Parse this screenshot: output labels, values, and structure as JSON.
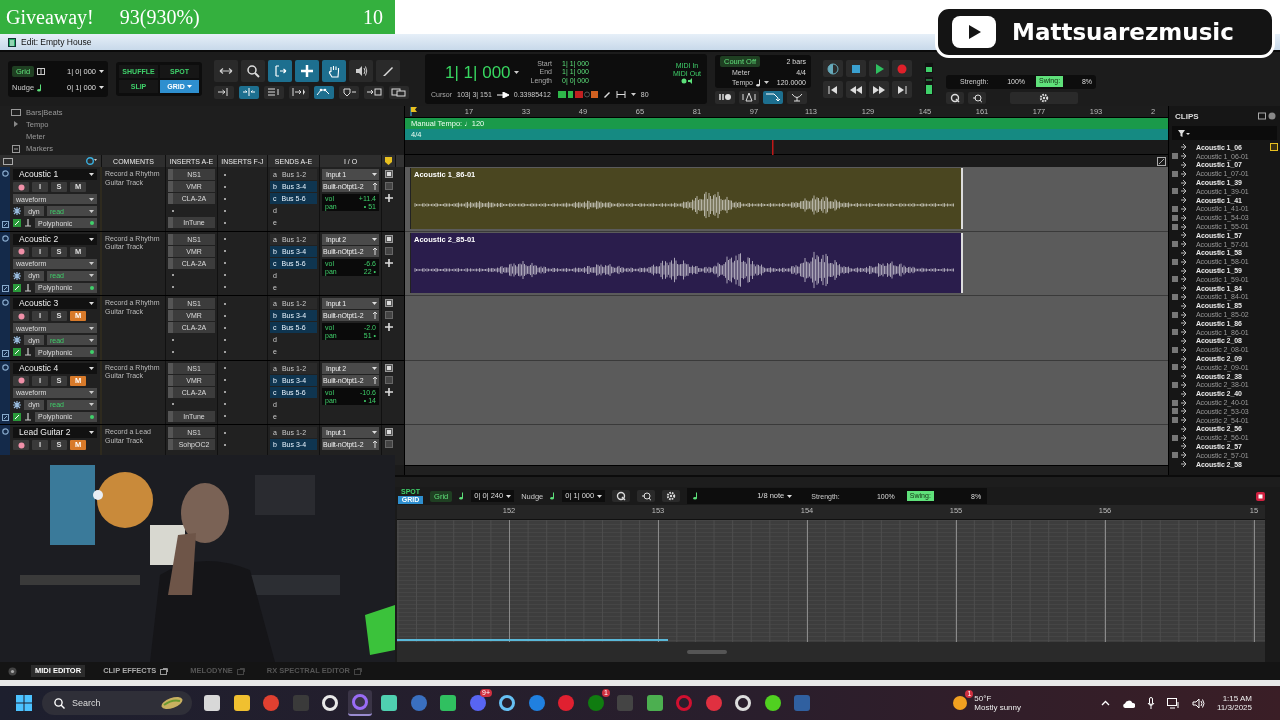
{
  "overlay_banner": {
    "title": "Giveaway!",
    "count": "93(930%)",
    "number": "10"
  },
  "channel_badge": {
    "name": "Mattsuarezmusic"
  },
  "window": {
    "title": "Edit: Empty House"
  },
  "toolbar": {
    "grid": {
      "label": "Grid",
      "value": "1| 0| 000"
    },
    "nudge": {
      "label": "Nudge",
      "value": "0| 1| 000"
    },
    "edit_modes": [
      {
        "label": "SHUFFLE",
        "selected": false
      },
      {
        "label": "SPOT",
        "selected": false
      },
      {
        "label": "SLIP",
        "selected": false
      },
      {
        "label": "GRID",
        "selected": true
      }
    ],
    "tools": [
      {
        "kind": "zoom-arrows",
        "selected": false
      },
      {
        "kind": "zoom",
        "selected": false
      },
      {
        "kind": "trim",
        "selected": true
      },
      {
        "kind": "selector",
        "selected": true
      },
      {
        "kind": "grabber",
        "selected": true
      },
      {
        "kind": "scrub",
        "selected": false
      },
      {
        "kind": "pencil",
        "selected": false
      }
    ],
    "tool_options": [
      {
        "kind": "tab-to-transient",
        "selected": false
      },
      {
        "kind": "link",
        "selected": true
      },
      {
        "kind": "lines",
        "selected": false
      },
      {
        "kind": "tab",
        "selected": false
      },
      {
        "kind": "automation",
        "selected": true
      },
      {
        "kind": "shield",
        "selected": false
      },
      {
        "kind": "link-select",
        "selected": false
      },
      {
        "kind": "windows",
        "selected": false
      }
    ],
    "counter": {
      "main": "1| 1| 000",
      "start_label": "Start",
      "start": "1| 1| 000",
      "end_label": "End",
      "end": "1| 1| 000",
      "length_label": "Length",
      "length": "0| 0| 000",
      "cursor_label": "Cursor",
      "cursor": "103| 3| 151",
      "sample": "0.33985412"
    },
    "midi": {
      "in": "MIDI In",
      "out": "MIDI Out",
      "value": "80"
    },
    "count": {
      "count_off": "Count Off",
      "bars": "2 bars",
      "meter_label": "Meter",
      "meter": "4/4",
      "tempo_label": "Tempo",
      "tempo": "120.0000"
    },
    "count_buttons": [
      {
        "kind": "pause",
        "selected": false
      },
      {
        "kind": "metronome",
        "selected": false
      },
      {
        "kind": "loop",
        "selected": true
      },
      {
        "kind": "conductor",
        "selected": false
      }
    ],
    "transport": [
      {
        "kind": "online"
      },
      {
        "kind": "stop"
      },
      {
        "kind": "play"
      },
      {
        "kind": "record"
      },
      {
        "kind": "start"
      },
      {
        "kind": "rewind"
      },
      {
        "kind": "forward"
      },
      {
        "kind": "end"
      }
    ],
    "quantize": {
      "strength_label": "Strength:",
      "strength": "100%",
      "swing_label": "Swing:",
      "swing": "8%"
    }
  },
  "rulers": {
    "labels": [
      "Bars|Beats",
      "Tempo",
      "Meter",
      "Markers"
    ],
    "bars": [
      "17",
      "33",
      "49",
      "65",
      "81",
      "97",
      "113",
      "129",
      "145",
      "161",
      "177",
      "193",
      "2"
    ],
    "tempo": "Manual Tempo: ♩120",
    "meter": "4/4"
  },
  "columns": [
    "COMMENTS",
    "INSERTS A-E",
    "INSERTS F-J",
    "SENDS A-E",
    "I / O"
  ],
  "tracks": [
    {
      "name": "Acoustic 1",
      "input_monitor": "I",
      "solo": "S",
      "mute": "M",
      "muted": false,
      "view": "waveform",
      "dyn": "dyn",
      "automation": "read",
      "elastic": "Polyphonic",
      "comment": "Record a Rhythm Guitar Track",
      "inserts": [
        {
          "kind": "plugin",
          "name": "NS1"
        },
        {
          "kind": "plugin",
          "name": "VMR"
        },
        {
          "kind": "plugin",
          "name": "CLA-2A"
        },
        {
          "kind": "empty"
        },
        {
          "kind": "plugin",
          "name": "InTune"
        }
      ],
      "inserts_fj": [
        {
          "kind": "empty"
        },
        {
          "kind": "empty"
        },
        {
          "kind": "empty"
        },
        {
          "kind": "empty"
        },
        {
          "kind": "empty"
        }
      ],
      "sends": [
        {
          "slot": "a",
          "bus": "Bus 1-2",
          "highlighted": false
        },
        {
          "slot": "b",
          "bus": "Bus 3-4",
          "highlighted": true
        },
        {
          "slot": "c",
          "bus": "Bus 5-6",
          "highlighted": true
        },
        {
          "slot": "d"
        },
        {
          "slot": "e"
        }
      ],
      "input": "Input 1",
      "output": "Built-nOtpt1-2",
      "volume": {
        "label": "vol",
        "value": "+11.4"
      },
      "pan": {
        "label": "pan",
        "value": "• 51"
      }
    },
    {
      "name": "Acoustic 2",
      "input_monitor": "I",
      "solo": "S",
      "mute": "M",
      "muted": false,
      "view": "waveform",
      "dyn": "dyn",
      "automation": "read",
      "elastic": "Polyphonic",
      "comment": "Record a Rhythm Guitar Track",
      "inserts": [
        {
          "kind": "plugin",
          "name": "NS1"
        },
        {
          "kind": "plugin",
          "name": "VMR"
        },
        {
          "kind": "plugin",
          "name": "CLA-2A"
        },
        {
          "kind": "empty"
        },
        {
          "kind": "empty"
        }
      ],
      "inserts_fj": [
        {
          "kind": "empty"
        },
        {
          "kind": "empty"
        },
        {
          "kind": "empty"
        },
        {
          "kind": "empty"
        },
        {
          "kind": "empty"
        }
      ],
      "sends": [
        {
          "slot": "a",
          "bus": "Bus 1-2",
          "highlighted": false
        },
        {
          "slot": "b",
          "bus": "Bus 3-4",
          "highlighted": true
        },
        {
          "slot": "c",
          "bus": "Bus 5-6",
          "highlighted": true
        },
        {
          "slot": "d"
        },
        {
          "slot": "e"
        }
      ],
      "input": "Input 2",
      "output": "Built-nOtpt1-2",
      "volume": {
        "label": "vol",
        "value": "-6.6"
      },
      "pan": {
        "label": "pan",
        "value": "22 •"
      }
    },
    {
      "name": "Acoustic 3",
      "input_monitor": "I",
      "solo": "S",
      "mute": "M",
      "muted": true,
      "view": "waveform",
      "dyn": "dyn",
      "automation": "read",
      "elastic": "Polyphonic",
      "comment": "Record a Rhythm Guitar Track",
      "inserts": [
        {
          "kind": "plugin",
          "name": "NS1"
        },
        {
          "kind": "plugin",
          "name": "VMR"
        },
        {
          "kind": "plugin",
          "name": "CLA-2A"
        },
        {
          "kind": "empty"
        },
        {
          "kind": "empty"
        }
      ],
      "inserts_fj": [
        {
          "kind": "empty"
        },
        {
          "kind": "empty"
        },
        {
          "kind": "empty"
        },
        {
          "kind": "empty"
        },
        {
          "kind": "empty"
        }
      ],
      "sends": [
        {
          "slot": "a",
          "bus": "Bus 1-2",
          "highlighted": false
        },
        {
          "slot": "b",
          "bus": "Bus 3-4",
          "highlighted": true
        },
        {
          "slot": "c",
          "bus": "Bus 5-6",
          "highlighted": true
        },
        {
          "slot": "d"
        },
        {
          "slot": "e"
        }
      ],
      "input": "Input 1",
      "output": "Built-nOtpt1-2",
      "volume": {
        "label": "vol",
        "value": "-2.0"
      },
      "pan": {
        "label": "pan",
        "value": "51 •"
      }
    },
    {
      "name": "Acoustic 4",
      "input_monitor": "I",
      "solo": "S",
      "mute": "M",
      "muted": true,
      "view": "waveform",
      "dyn": "dyn",
      "automation": "read",
      "elastic": "Polyphonic",
      "comment": "Record a Rhythm Guitar Track",
      "inserts": [
        {
          "kind": "plugin",
          "name": "NS1"
        },
        {
          "kind": "plugin",
          "name": "VMR"
        },
        {
          "kind": "plugin",
          "name": "CLA-2A"
        },
        {
          "kind": "empty"
        },
        {
          "kind": "plugin",
          "name": "InTune"
        }
      ],
      "inserts_fj": [
        {
          "kind": "empty"
        },
        {
          "kind": "empty"
        },
        {
          "kind": "empty"
        },
        {
          "kind": "empty"
        },
        {
          "kind": "empty"
        }
      ],
      "sends": [
        {
          "slot": "a",
          "bus": "Bus 1-2",
          "highlighted": false
        },
        {
          "slot": "b",
          "bus": "Bus 3-4",
          "highlighted": true
        },
        {
          "slot": "c",
          "bus": "Bus 5-6",
          "highlighted": true
        },
        {
          "slot": "d"
        },
        {
          "slot": "e"
        }
      ],
      "input": "Input 2",
      "output": "Built-nOtpt1-2",
      "volume": {
        "label": "vol",
        "value": "-10.6"
      },
      "pan": {
        "label": "pan",
        "value": "• 14"
      }
    },
    {
      "name": "Lead Guitar 2",
      "input_monitor": "I",
      "solo": "S",
      "mute": "M",
      "muted": true,
      "comment": "Record a Lead Guitar Track",
      "inserts": [
        {
          "kind": "plugin",
          "name": "NS1"
        },
        {
          "kind": "plugin",
          "name": "SohpOC2"
        }
      ],
      "inserts_fj": [
        {
          "kind": "empty"
        },
        {
          "kind": "empty"
        }
      ],
      "sends": [
        {
          "slot": "a",
          "bus": "Bus 1-2",
          "highlighted": false
        },
        {
          "slot": "b",
          "bus": "Bus 3-4",
          "highlighted": true
        }
      ],
      "input": "Input 1",
      "output": "Built-nOtpt1-2"
    }
  ],
  "clips": [
    {
      "name": "Acoustic 1_86-01",
      "color": "#4a4620"
    },
    {
      "name": "Acoustic 2_85-01",
      "color": "#2a1d4c"
    }
  ],
  "clip_list": {
    "title": "CLIPS",
    "items": [
      {
        "name": "Acoustic 1_06",
        "kind": "file"
      },
      {
        "name": "Acoustic 1_06-01",
        "kind": "clip"
      },
      {
        "name": "Acoustic 1_07",
        "kind": "file"
      },
      {
        "name": "Acoustic 1_07-01",
        "kind": "clip"
      },
      {
        "name": "Acoustic 1_39",
        "kind": "file"
      },
      {
        "name": "Acoustic 1_39-01",
        "kind": "clip"
      },
      {
        "name": "Acoustic 1_41",
        "kind": "file"
      },
      {
        "name": "Acoustic 1_41-01",
        "kind": "clip"
      },
      {
        "name": "Acoustic 1_54-03",
        "kind": "clip"
      },
      {
        "name": "Acoustic 1_55-01",
        "kind": "clip"
      },
      {
        "name": "Acoustic 1_57",
        "kind": "file"
      },
      {
        "name": "Acoustic 1_57-01",
        "kind": "clip"
      },
      {
        "name": "Acoustic 1_58",
        "kind": "file"
      },
      {
        "name": "Acoustic 1_58-01",
        "kind": "clip"
      },
      {
        "name": "Acoustic 1_59",
        "kind": "file"
      },
      {
        "name": "Acoustic 1_59-01",
        "kind": "clip"
      },
      {
        "name": "Acoustic 1_84",
        "kind": "file"
      },
      {
        "name": "Acoustic 1_84-01",
        "kind": "clip"
      },
      {
        "name": "Acoustic 1_85",
        "kind": "file"
      },
      {
        "name": "Acoustic 1_85-02",
        "kind": "clip"
      },
      {
        "name": "Acoustic 1_86",
        "kind": "file"
      },
      {
        "name": "Acoustic 1_86-01",
        "kind": "clip"
      },
      {
        "name": "Acoustic 2_08",
        "kind": "file"
      },
      {
        "name": "Acoustic 2_08-01",
        "kind": "clip"
      },
      {
        "name": "Acoustic 2_09",
        "kind": "file"
      },
      {
        "name": "Acoustic 2_09-01",
        "kind": "clip"
      },
      {
        "name": "Acoustic 2_38",
        "kind": "file"
      },
      {
        "name": "Acoustic 2_38-01",
        "kind": "clip"
      },
      {
        "name": "Acoustic 2_40",
        "kind": "file"
      },
      {
        "name": "Acoustic 2_40-01",
        "kind": "clip"
      },
      {
        "name": "Acoustic 2_53-03",
        "kind": "clip"
      },
      {
        "name": "Acoustic 2_54-01",
        "kind": "clip"
      },
      {
        "name": "Acoustic 2_56",
        "kind": "file"
      },
      {
        "name": "Acoustic 2_56-01",
        "kind": "clip"
      },
      {
        "name": "Acoustic 2_57",
        "kind": "file"
      },
      {
        "name": "Acoustic 2_57-01",
        "kind": "clip"
      },
      {
        "name": "Acoustic 2_58",
        "kind": "file"
      }
    ]
  },
  "midi_editor": {
    "modes": [
      {
        "label": "SPOT",
        "selected": false
      },
      {
        "label": "GRID",
        "selected": true
      }
    ],
    "grid_label": "Grid",
    "grid": "0| 0| 240",
    "nudge_label": "Nudge",
    "nudge": "0| 1| 000",
    "note": "1/8 note",
    "strength_label": "Strength:",
    "strength": "100%",
    "swing_label": "Swing:",
    "swing": "8%",
    "bars": [
      "152",
      "153",
      "154",
      "155",
      "156",
      "15"
    ]
  },
  "bottom_tabs": [
    {
      "label": "MIDI EDITOR",
      "selected": true,
      "disabled": false
    },
    {
      "label": "CLIP EFFECTS",
      "selected": false,
      "disabled": false
    },
    {
      "label": "MELODYNE",
      "selected": false,
      "disabled": true
    },
    {
      "label": "RX SPECTRAL EDITOR",
      "selected": false,
      "disabled": true
    }
  ],
  "webcam": {
    "kind": "picture"
  },
  "taskbar": {
    "search": "Search",
    "apps": [
      {
        "kind": "tile",
        "color": "#d8d8d8",
        "selected": false
      },
      {
        "kind": "tile",
        "color": "#f0c030",
        "selected": false
      },
      {
        "kind": "circle",
        "color": "#e04030",
        "selected": false
      },
      {
        "kind": "tile",
        "color": "#3a3a3a",
        "selected": false
      },
      {
        "kind": "ring",
        "color": "#e8e8e8",
        "selected": false
      },
      {
        "kind": "ring",
        "color": "#9a6cf5",
        "selected": true
      },
      {
        "kind": "tile",
        "color": "#4fd0b0",
        "selected": false
      },
      {
        "kind": "circle",
        "color": "#3a70c0",
        "selected": false
      },
      {
        "kind": "tile",
        "color": "#30c060",
        "selected": false
      },
      {
        "kind": "circle",
        "color": "#5865f2",
        "selected": false,
        "badge": "9+"
      },
      {
        "kind": "ring",
        "color": "#66c0f4",
        "selected": false
      },
      {
        "kind": "circle",
        "color": "#2080e0",
        "selected": false
      },
      {
        "kind": "circle",
        "color": "#e02030",
        "selected": false
      },
      {
        "kind": "circle",
        "color": "#107c10",
        "selected": false,
        "badge": "1"
      },
      {
        "kind": "tile",
        "color": "#444444",
        "selected": false
      },
      {
        "kind": "tile",
        "color": "#4caf50",
        "selected": false
      },
      {
        "kind": "ring",
        "color": "#d01030",
        "selected": false
      },
      {
        "kind": "circle",
        "color": "#e03040",
        "selected": false
      },
      {
        "kind": "ring",
        "color": "#dddddd",
        "selected": false
      },
      {
        "kind": "circle",
        "color": "#50d020",
        "selected": false
      },
      {
        "kind": "tile",
        "color": "#3060a0",
        "selected": false
      }
    ],
    "weather_badge": "1",
    "temperature": "50°F",
    "weather": "Mostly sunny",
    "time": "1:15 AM",
    "date": "11/3/2025"
  }
}
